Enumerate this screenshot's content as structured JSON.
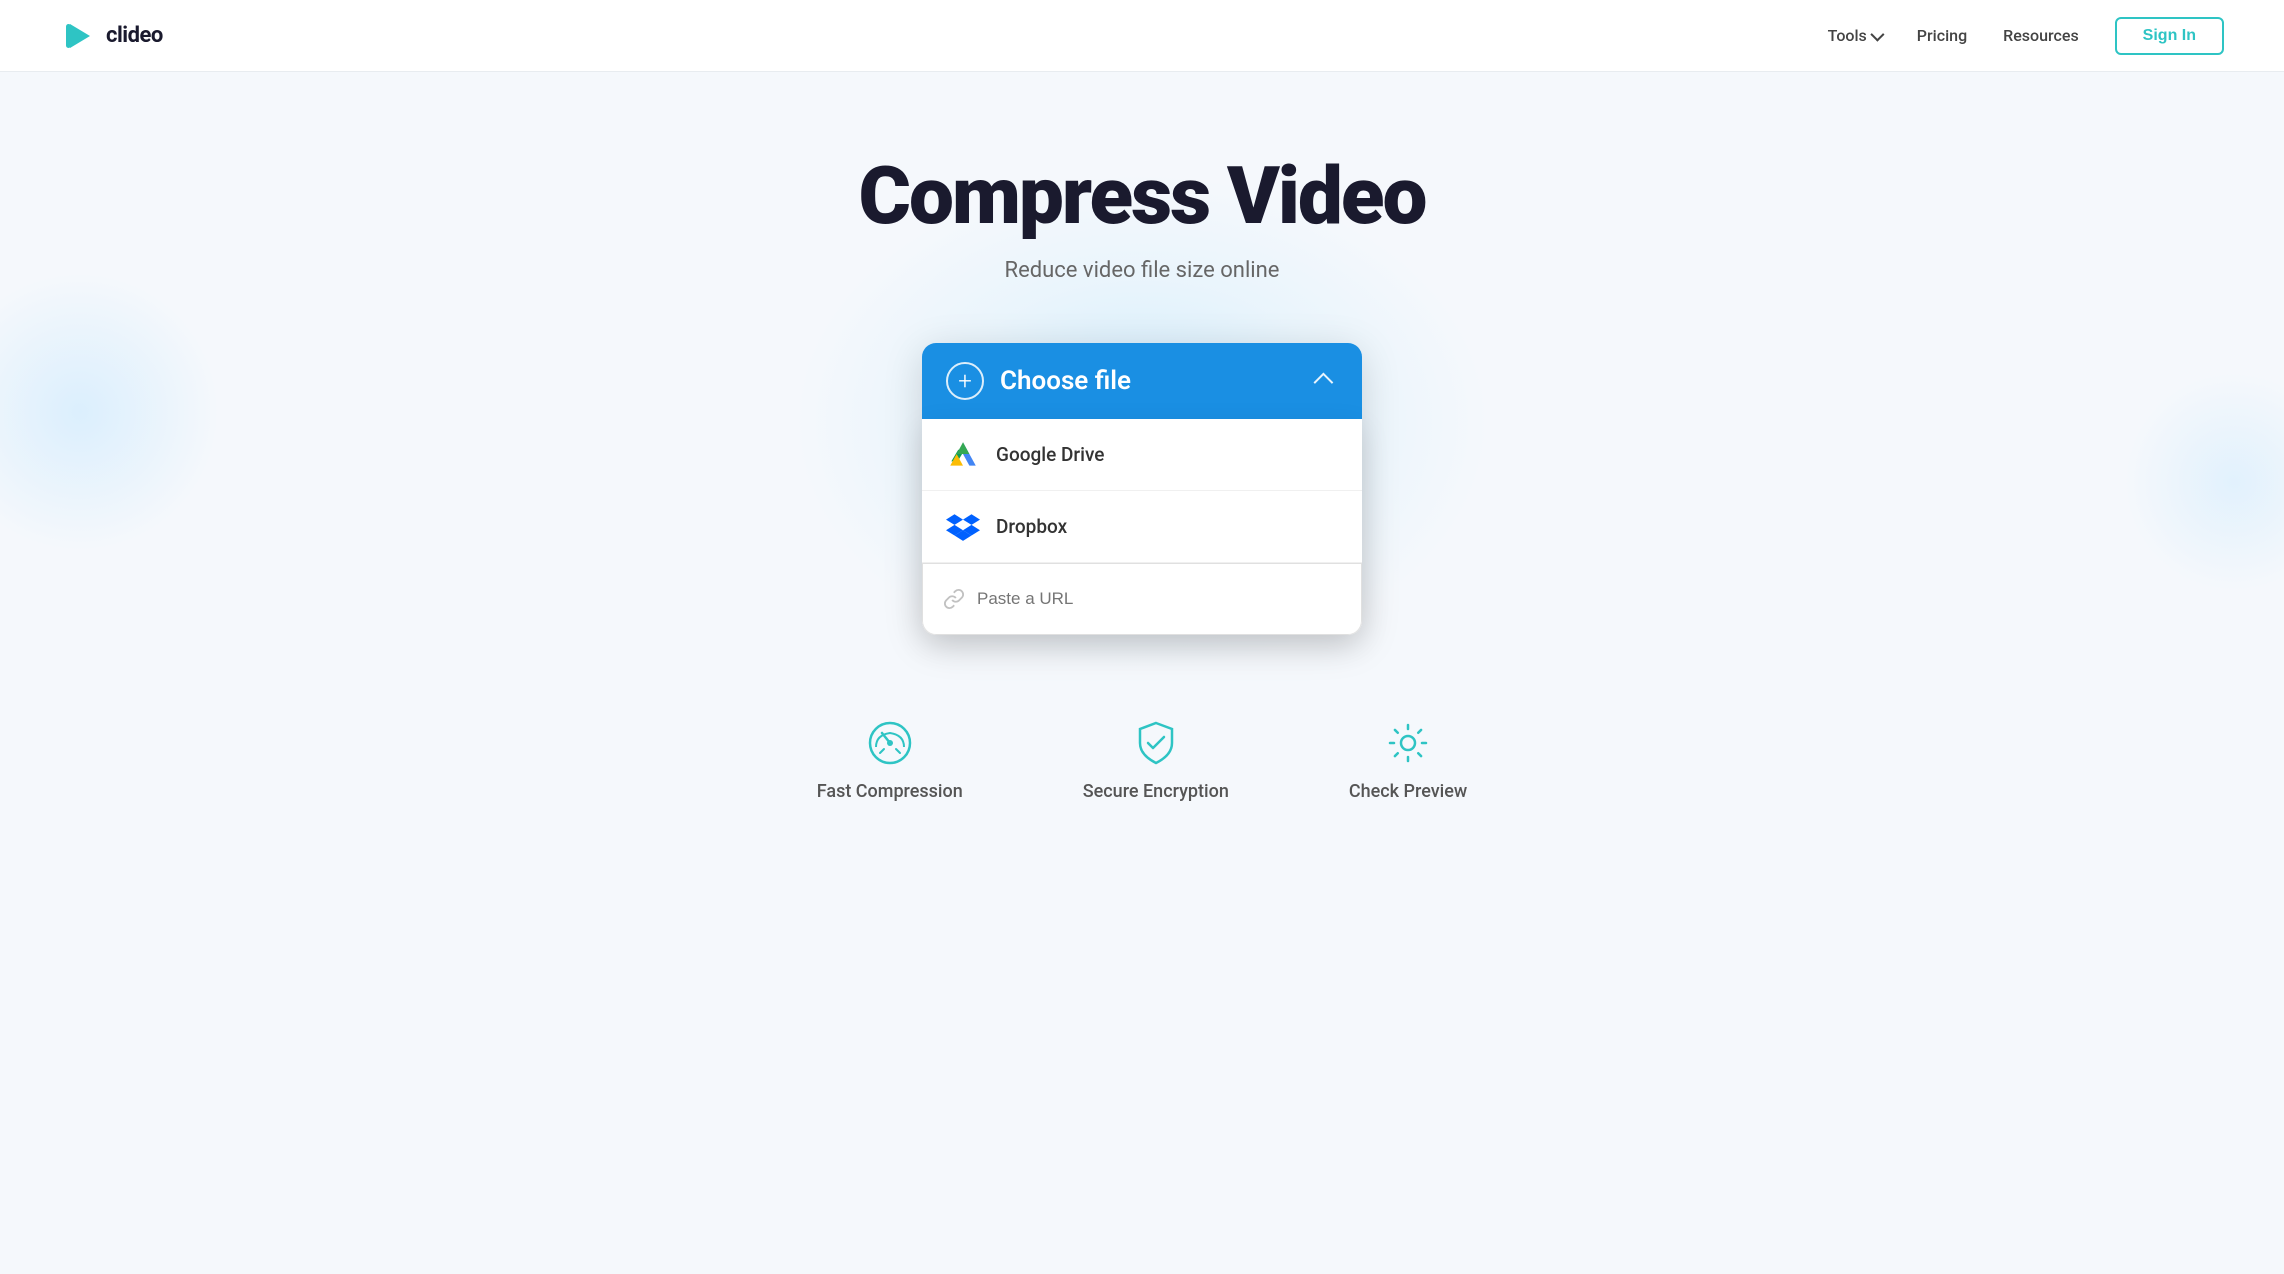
{
  "header": {
    "logo_text": "clideo",
    "nav": {
      "tools_label": "Tools",
      "pricing_label": "Pricing",
      "resources_label": "Resources",
      "sign_in_label": "Sign In"
    }
  },
  "hero": {
    "title": "Compress Video",
    "subtitle": "Reduce video file size online"
  },
  "upload_widget": {
    "choose_file_label": "Choose file",
    "google_drive_label": "Google Drive",
    "dropbox_label": "Dropbox",
    "url_placeholder": "Paste a URL"
  },
  "features": [
    {
      "id": "fast-compression",
      "label": "Fast Compression",
      "icon": "speedometer-icon"
    },
    {
      "id": "secure-encryption",
      "label": "Secure Encryption",
      "icon": "shield-icon"
    },
    {
      "id": "check-preview",
      "label": "Check Preview",
      "icon": "gear-icon"
    }
  ]
}
